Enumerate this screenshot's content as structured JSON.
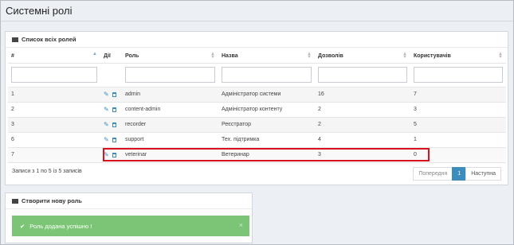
{
  "page": {
    "title": "Системні ролі"
  },
  "roles_box": {
    "title": "Список всіх ролей",
    "columns": [
      "#",
      "Дії",
      "Роль",
      "Назва",
      "Дозволів",
      "Користувачів"
    ],
    "rows": [
      {
        "id": "1",
        "role": "admin",
        "name": "Адміністратор системи",
        "permissions": "16",
        "users": "7"
      },
      {
        "id": "2",
        "role": "content-admin",
        "name": "Адміністратор контенту",
        "permissions": "2",
        "users": "3"
      },
      {
        "id": "3",
        "role": "recorder",
        "name": "Реєстратор",
        "permissions": "2",
        "users": "5"
      },
      {
        "id": "6",
        "role": "support",
        "name": "Тех. підтримка",
        "permissions": "4",
        "users": "1"
      },
      {
        "id": "7",
        "role": "veterinar",
        "name": "Ветеринар",
        "permissions": "3",
        "users": "0"
      }
    ],
    "info": "Записи з 1 по 5 із 5 записів",
    "pagination": {
      "prev": "Попередня",
      "current": "1",
      "next": "Наступна"
    }
  },
  "create_box": {
    "title": "Створити нову роль",
    "alert": "Роль додана успішно !",
    "alert_close": "×"
  },
  "icons": {
    "edit": "pencil-icon",
    "delete": "trash-icon",
    "list": "list-icon",
    "success": "check-icon"
  },
  "colors": {
    "accent": "#3c8dbc",
    "success": "#7cc576",
    "highlight": "#d9121f"
  }
}
